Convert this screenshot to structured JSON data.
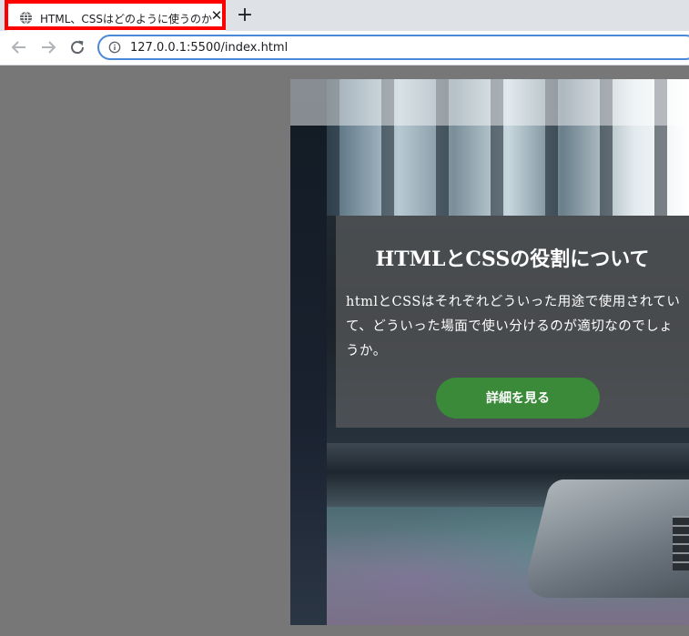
{
  "browser": {
    "tab": {
      "title": "HTML、CSSはどのように使うのか",
      "close_symbol": "✕",
      "icon": "globe-icon"
    },
    "new_tab_symbol": "+",
    "toolbar": {
      "back_icon": "arrow-left-icon",
      "forward_icon": "arrow-right-icon",
      "reload_icon": "reload-icon",
      "info_icon": "info-icon",
      "url": "127.0.0.1:5500/index.html"
    },
    "highlight_color": "#ff0000"
  },
  "page": {
    "hero": {
      "image": "photo-window-laptop",
      "card": {
        "title": "HTMLとCSSの役割について",
        "body": "htmlとCSSはそれぞれどういった用途で使用されていて、どういった場面で使い分けるのが適切なのでしょうか。",
        "button_label": "詳細を見る",
        "button_color": "#3a8a3a"
      }
    },
    "background_color": "#777777"
  }
}
